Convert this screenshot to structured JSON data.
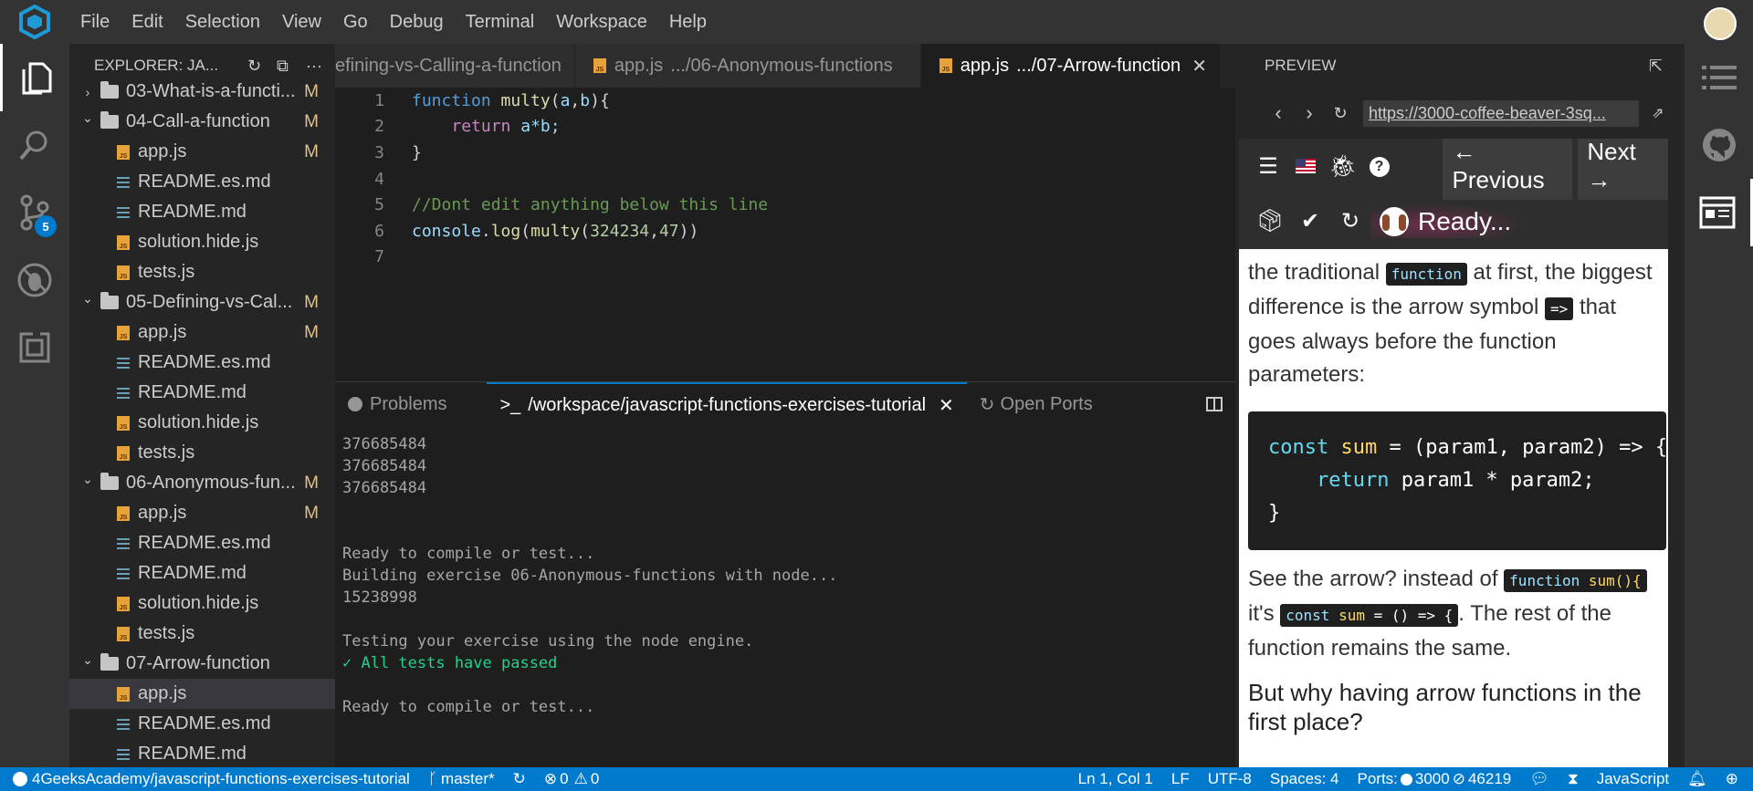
{
  "menu": [
    "File",
    "Edit",
    "Selection",
    "View",
    "Go",
    "Debug",
    "Terminal",
    "Workspace",
    "Help"
  ],
  "activity": {
    "scm_badge": "5"
  },
  "explorer": {
    "title": "EXPLORER: JA...",
    "items": [
      {
        "kind": "folder",
        "name": "03-What-is-a-functi...",
        "mod": "M",
        "open": false
      },
      {
        "kind": "folder",
        "name": "04-Call-a-function",
        "mod": "M",
        "open": true
      },
      {
        "kind": "js",
        "name": "app.js",
        "mod": "M"
      },
      {
        "kind": "md",
        "name": "README.es.md",
        "mod": ""
      },
      {
        "kind": "md",
        "name": "README.md",
        "mod": ""
      },
      {
        "kind": "js",
        "name": "solution.hide.js",
        "mod": ""
      },
      {
        "kind": "js",
        "name": "tests.js",
        "mod": ""
      },
      {
        "kind": "folder",
        "name": "05-Defining-vs-Cal...",
        "mod": "M",
        "open": true
      },
      {
        "kind": "js",
        "name": "app.js",
        "mod": "M"
      },
      {
        "kind": "md",
        "name": "README.es.md",
        "mod": ""
      },
      {
        "kind": "md",
        "name": "README.md",
        "mod": ""
      },
      {
        "kind": "js",
        "name": "solution.hide.js",
        "mod": ""
      },
      {
        "kind": "js",
        "name": "tests.js",
        "mod": ""
      },
      {
        "kind": "folder",
        "name": "06-Anonymous-fun...",
        "mod": "M",
        "open": true
      },
      {
        "kind": "js",
        "name": "app.js",
        "mod": "M"
      },
      {
        "kind": "md",
        "name": "README.es.md",
        "mod": ""
      },
      {
        "kind": "md",
        "name": "README.md",
        "mod": ""
      },
      {
        "kind": "js",
        "name": "solution.hide.js",
        "mod": ""
      },
      {
        "kind": "js",
        "name": "tests.js",
        "mod": ""
      },
      {
        "kind": "folder",
        "name": "07-Arrow-function",
        "mod": "",
        "open": true
      },
      {
        "kind": "js",
        "name": "app.js",
        "mod": "",
        "selected": true
      },
      {
        "kind": "md",
        "name": "README.es.md",
        "mod": ""
      },
      {
        "kind": "md",
        "name": "README.md",
        "mod": ""
      }
    ]
  },
  "tabs": [
    {
      "label": "efining-vs-Calling-a-function",
      "js": false,
      "active": false
    },
    {
      "label": "app.js",
      "path": ".../06-Anonymous-functions",
      "js": true,
      "active": false
    },
    {
      "label": "app.js",
      "path": ".../07-Arrow-function",
      "js": true,
      "active": true
    }
  ],
  "editor": {
    "line_numbers": [
      "1",
      "2",
      "3",
      "4",
      "5",
      "6",
      "7"
    ],
    "l1": {
      "kw": "function",
      "fn": "multy",
      "p1": "(",
      "a": "a",
      "comma": ",",
      "b": "b",
      "p2": "){"
    },
    "l2": {
      "kw": "return",
      "expr": "a*b;"
    },
    "l3": "}",
    "l5": "//Dont edit anything below this line",
    "l6": {
      "obj": "console",
      "dot": ".",
      "log": "log",
      "p1": "(",
      "fn": "multy",
      "p2": "(",
      "n1": "324234",
      "comma": ",",
      "n2": "47",
      "p3": "))"
    }
  },
  "panel": {
    "tabs": [
      "Problems",
      "/workspace/javascript-functions-exercises-tutorial",
      "Open Ports"
    ],
    "terminal": [
      "376685484",
      "376685484",
      "376685484",
      "",
      "",
      "Ready to compile or test...",
      "Building exercise 06-Anonymous-functions with node...",
      "15238998",
      "",
      "Testing your exercise using the node engine.",
      "✓ All tests have passed",
      "",
      "Ready to compile or test..."
    ]
  },
  "preview": {
    "title": "PREVIEW",
    "url": "https://3000-coffee-beaver-3sq...",
    "prev_label": "Previous",
    "next_label": "Next",
    "status": "Ready...",
    "para1": {
      "a": "the traditional ",
      "code1": "function",
      "b": " at first, the biggest difference is the arrow symbol ",
      "code2": "=>",
      "c": " that goes always before the function parameters:"
    },
    "code": {
      "l1": {
        "kw": "const",
        "name": "sum",
        "rest": " = (param1, param2) => {"
      },
      "l2": {
        "kw": "return",
        "rest": " param1 * param2;"
      },
      "l3": "}"
    },
    "para2": {
      "a": "See the arrow? instead of ",
      "code1a": "function",
      "code1b": "sum(){",
      "b": " it's ",
      "code2a": "const",
      "code2b": "sum",
      "code2c": " = () => {",
      "c": ". The rest of the function remains the same."
    },
    "heading": "But why having arrow functions in the first place?"
  },
  "status": {
    "repo": "4GeeksAcademy/javascript-functions-exercises-tutorial",
    "branch": "master*",
    "errors": "0",
    "warnings": "0",
    "position": "Ln 1, Col 1",
    "eol": "LF",
    "encoding": "UTF-8",
    "spaces": "Spaces: 4",
    "ports_label": "Ports:",
    "port1": "3000",
    "port2": "46219",
    "language": "JavaScript"
  },
  "colors": {
    "accent": "#007acc",
    "modified": "#e2c08d",
    "js_icon": "#e8a23a"
  }
}
